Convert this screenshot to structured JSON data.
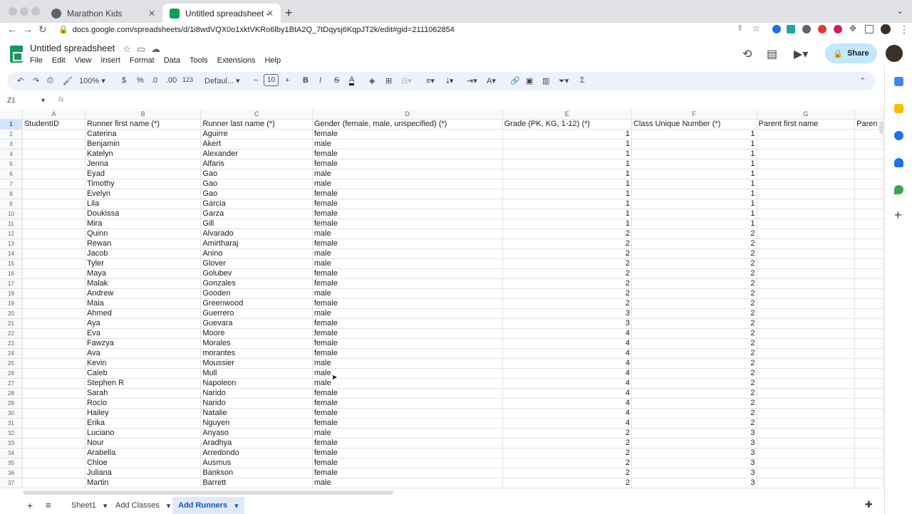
{
  "browser": {
    "tabs": [
      {
        "title": "Marathon Kids",
        "active": false
      },
      {
        "title": "Untitled spreadsheet - Google",
        "active": true
      }
    ],
    "url": "docs.google.com/spreadsheets/d/1i8wdVQX0o1xktVKRo6lby1BtA2Q_7tDqysj6KqpJT2k/edit#gid=2111062854"
  },
  "app": {
    "doc_title": "Untitled spreadsheet",
    "menus": [
      "File",
      "Edit",
      "View",
      "Insert",
      "Format",
      "Data",
      "Tools",
      "Extensions",
      "Help"
    ],
    "share_label": "Share"
  },
  "toolbar": {
    "zoom": "100%",
    "currency": "$",
    "percent": "%",
    "dec_decrease": ".0",
    "dec_increase": ".00",
    "more_formats": "123",
    "font": "Defaul...",
    "font_size": "10",
    "bold": "B",
    "italic": "I",
    "strike": "S",
    "text_color": "A"
  },
  "formula_bar": {
    "cell_ref": "Z1",
    "fx": "fx"
  },
  "grid": {
    "columns": [
      "A",
      "B",
      "C",
      "D",
      "E",
      "F",
      "G"
    ],
    "headers": [
      "StudentID",
      "Runner first name (*)",
      "Runner last name (*)",
      "Gender (female, male, unspecified) (*)",
      "Grade (PK, KG, 1-12) (*)",
      "Class Unique Number (*)",
      "Parent first name",
      "Paren"
    ],
    "rows": [
      [
        "",
        "Caterina",
        "Aguirre",
        "female",
        "1",
        "1"
      ],
      [
        "",
        "Benjamin",
        "Akert",
        "male",
        "1",
        "1"
      ],
      [
        "",
        "Katelyn",
        "Alexander",
        "female",
        "1",
        "1"
      ],
      [
        "",
        "Jenna",
        "Alfaris",
        "female",
        "1",
        "1"
      ],
      [
        "",
        "Eyad",
        "Gao",
        "male",
        "1",
        "1"
      ],
      [
        "",
        "Timothy",
        "Gao",
        "male",
        "1",
        "1"
      ],
      [
        "",
        "Evelyn",
        "Gao",
        "female",
        "1",
        "1"
      ],
      [
        "",
        "Lila",
        "Garcia",
        "female",
        "1",
        "1"
      ],
      [
        "",
        "Doukissa",
        "Garza",
        "female",
        "1",
        "1"
      ],
      [
        "",
        "Mira",
        "Gill",
        "female",
        "1",
        "1"
      ],
      [
        "",
        "Quinn",
        "Alvarado",
        "male",
        "2",
        "2"
      ],
      [
        "",
        "Rewan",
        "Amirtharaj",
        "female",
        "2",
        "2"
      ],
      [
        "",
        "Jacob",
        "Anino",
        "male",
        "2",
        "2"
      ],
      [
        "",
        "Tyler",
        "Glover",
        "male",
        "2",
        "2"
      ],
      [
        "",
        "Maya",
        "Golubev",
        "female",
        "2",
        "2"
      ],
      [
        "",
        "Malak",
        "Gonzales",
        "female",
        "2",
        "2"
      ],
      [
        "",
        "Andrew",
        "Gooden",
        "male",
        "2",
        "2"
      ],
      [
        "",
        "Maia",
        "Greenwood",
        "female",
        "2",
        "2"
      ],
      [
        "",
        "Ahmed",
        "Guerrero",
        "male",
        "3",
        "2"
      ],
      [
        "",
        "Aya",
        "Guevara",
        "female",
        "3",
        "2"
      ],
      [
        "",
        "Eva",
        "Moore",
        "female",
        "4",
        "2"
      ],
      [
        "",
        "Fawzya",
        "Morales",
        "female",
        "4",
        "2"
      ],
      [
        "",
        "Ava",
        "morantes",
        "female",
        "4",
        "2"
      ],
      [
        "",
        "Kevin",
        "Moussier",
        "male",
        "4",
        "2"
      ],
      [
        "",
        "Caleb",
        "Mull",
        "male",
        "4",
        "2"
      ],
      [
        "",
        "Stephen R",
        "Napoleon",
        "male",
        "4",
        "2"
      ],
      [
        "",
        "Sarah",
        "Narido",
        "female",
        "4",
        "2"
      ],
      [
        "",
        "Rocio",
        "Narido",
        "female",
        "4",
        "2"
      ],
      [
        "",
        "Hailey",
        "Natalie",
        "female",
        "4",
        "2"
      ],
      [
        "",
        "Erika",
        "Nguyen",
        "female",
        "4",
        "2"
      ],
      [
        "",
        "Luciano",
        "Anyaso",
        "male",
        "2",
        "3"
      ],
      [
        "",
        "Nour",
        "Aradhya",
        "female",
        "2",
        "3"
      ],
      [
        "",
        "Arabella",
        "Arredondo",
        "female",
        "2",
        "3"
      ],
      [
        "",
        "Chloe",
        "Ausmus",
        "female",
        "2",
        "3"
      ],
      [
        "",
        "Juliana",
        "Bankson",
        "female",
        "2",
        "3"
      ],
      [
        "",
        "Martin",
        "Barrett",
        "male",
        "2",
        "3"
      ]
    ]
  },
  "sheets": [
    {
      "name": "Sheet1",
      "active": false
    },
    {
      "name": "Add Classes",
      "active": false
    },
    {
      "name": "Add Runners",
      "active": true
    }
  ],
  "colors": {
    "accent": "#0b57d0",
    "share_bg": "#c2e7ff",
    "toolbar_bg": "#edf2fa",
    "sheets_green": "#0f9d58"
  }
}
